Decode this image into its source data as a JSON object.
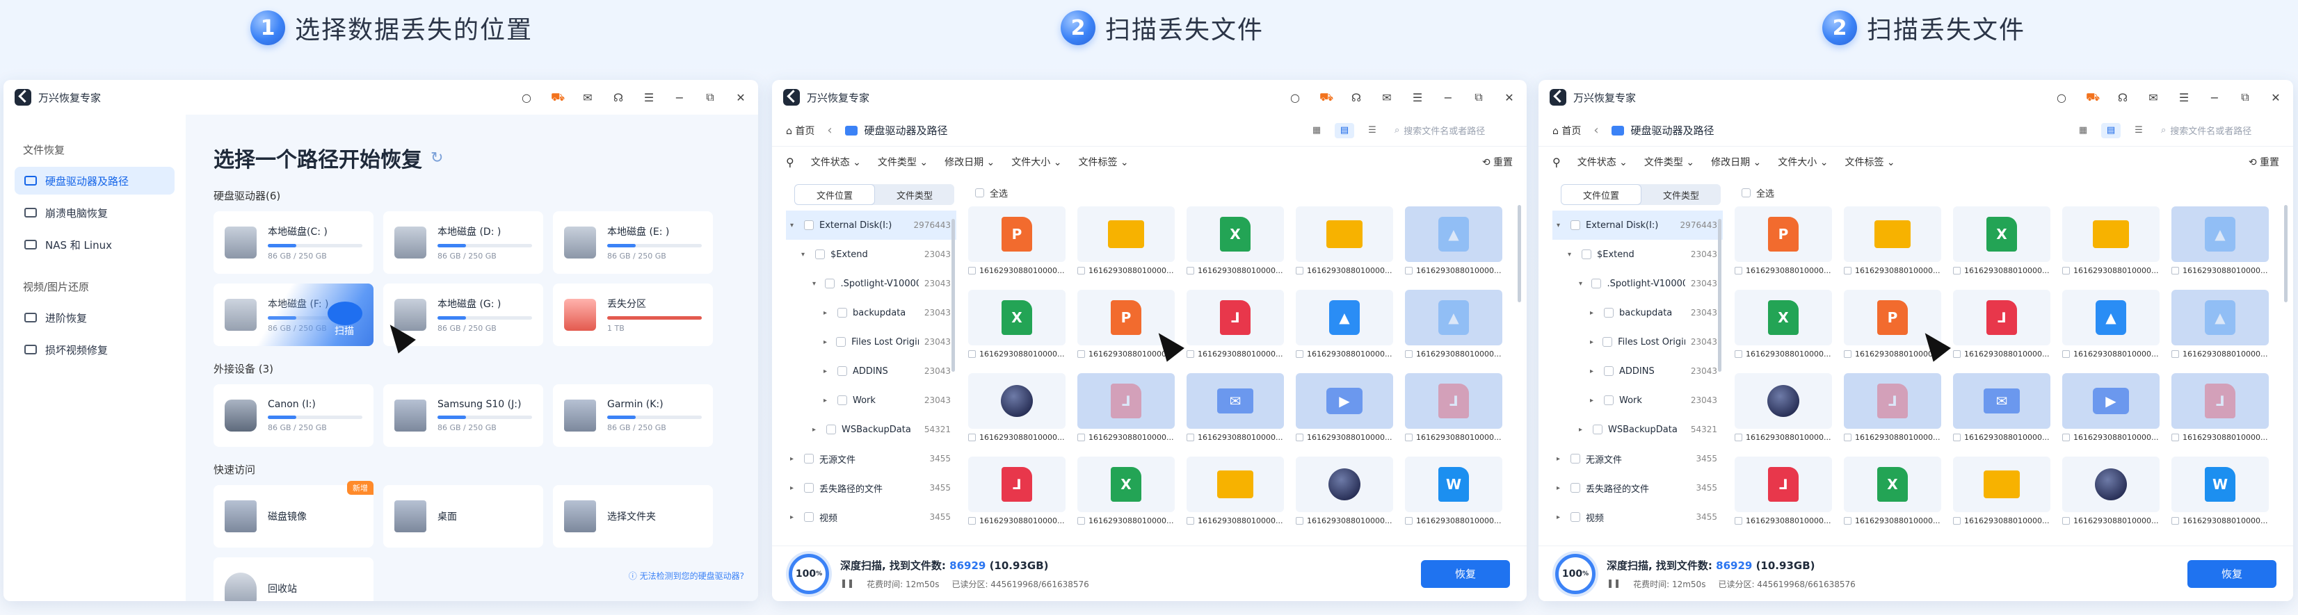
{
  "steps": [
    {
      "num": "1",
      "text": "选择数据丢失的位置"
    },
    {
      "num": "2",
      "text": "扫描丢失文件"
    },
    {
      "num": "2",
      "text": "扫描丢失文件"
    }
  ],
  "app_title": "万兴恢复专家",
  "win1": {
    "sidebar": {
      "sec1": "文件恢复",
      "items1": [
        "硬盘驱动器及路径",
        "崩溃电脑恢复",
        "NAS 和 Linux"
      ],
      "sec2": "视频/图片还原",
      "items2": [
        "进阶恢复",
        "损坏视频修复"
      ]
    },
    "heading": "选择一个路径开始恢复",
    "hdd_label": "硬盘驱动器(6)",
    "drives": [
      {
        "name": "本地磁盘(C: )",
        "size": "86 GB / 250 GB",
        "pct": 30
      },
      {
        "name": "本地磁盘 (D: )",
        "size": "86 GB / 250 GB",
        "pct": 30
      },
      {
        "name": "本地磁盘 (E: )",
        "size": "86 GB / 250 GB",
        "pct": 30
      },
      {
        "name": "本地磁盘 (F: )",
        "size": "86 GB / 250 GB",
        "pct": 30,
        "scan": "扫描"
      },
      {
        "name": "本地磁盘 (G: )",
        "size": "86 GB / 250 GB",
        "pct": 30
      },
      {
        "name": "丢失分区",
        "size": "1 TB",
        "pct": 100
      }
    ],
    "ext_label": "外接设备 (3)",
    "ext": [
      {
        "name": "Canon (I:)",
        "size": "86 GB / 250 GB",
        "pct": 30
      },
      {
        "name": "Samsung S10 (J:)",
        "size": "86 GB / 250 GB",
        "pct": 30
      },
      {
        "name": "Garmin (K:)",
        "size": "86 GB / 250 GB",
        "pct": 30
      }
    ],
    "quick_label": "快速访问",
    "quick": [
      {
        "name": "磁盘镜像",
        "badge": "新增"
      },
      {
        "name": "桌面"
      },
      {
        "name": "选择文件夹"
      },
      {
        "name": "回收站"
      }
    ],
    "hint": "无法检测到您的硬盘驱动器?"
  },
  "scan": {
    "home": "首页",
    "path": "硬盘驱动器及路径",
    "search_placeholder": "搜索文件名或者路径",
    "filters": [
      "文件状态",
      "文件类型",
      "修改日期",
      "文件大小",
      "文件标签"
    ],
    "reset": "重置",
    "tabs": [
      "文件位置",
      "文件类型"
    ],
    "tree": [
      {
        "label": "External Disk(I:)",
        "count": "2976443",
        "arrow": "▾",
        "sel": true
      },
      {
        "label": "$Extend",
        "count": "23043",
        "arrow": "▾"
      },
      {
        "label": ".Spotlight-V10000...",
        "count": "23043",
        "arrow": "▾"
      },
      {
        "label": "backupdata",
        "count": "23043",
        "arrow": "▸"
      },
      {
        "label": "Files Lost Origin...",
        "count": "23043",
        "arrow": "▸"
      },
      {
        "label": "ADDINS",
        "count": "23043",
        "arrow": "▸"
      },
      {
        "label": "Work",
        "count": "23043",
        "arrow": "▸"
      },
      {
        "label": "WSBackupData",
        "count": "54321",
        "arrow": "▸"
      },
      {
        "label": "无源文件",
        "count": "3455",
        "arrow": "▸"
      },
      {
        "label": "丢失路径的文件",
        "count": "3455",
        "arrow": "▸"
      },
      {
        "label": "视频",
        "count": "3455",
        "arrow": "▸"
      }
    ],
    "select_all": "全选",
    "file_name": "1616293088010000...",
    "files": [
      "pp",
      "fold",
      "xl",
      "fold",
      "img",
      "xl",
      "pp",
      "pdf",
      "img",
      "img",
      "c4d",
      "pdf",
      "mail",
      "vid",
      "pdf",
      "pdf",
      "xl",
      "fold",
      "c4d",
      "wd"
    ],
    "highlight": [
      4,
      9,
      11,
      12,
      13,
      14
    ],
    "progress": "100",
    "progress_unit": "%",
    "status": "深度扫描, 找到文件数:",
    "found": "86929",
    "found_size": "(10.93GB)",
    "elapsed": "花费时间: 12m50s",
    "sectors": "已读分区: 445619968/661638576",
    "recover": "恢复"
  }
}
